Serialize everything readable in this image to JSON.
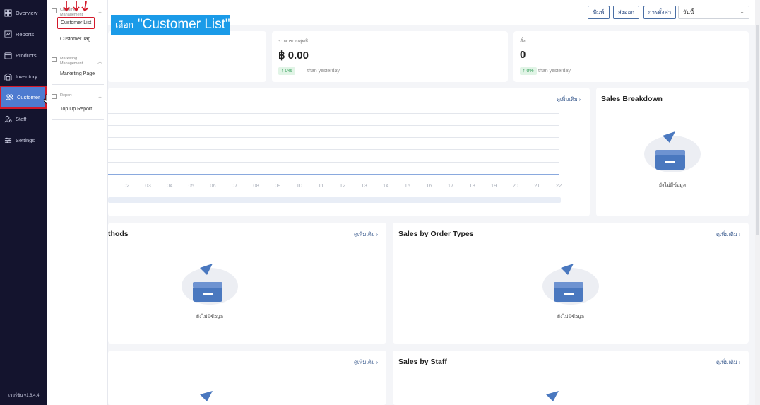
{
  "sidebar": {
    "items": [
      {
        "label": "Overview",
        "icon": "grid-icon"
      },
      {
        "label": "Reports",
        "icon": "chart-icon"
      },
      {
        "label": "Products",
        "icon": "box-icon"
      },
      {
        "label": "Inventory",
        "icon": "warehouse-icon"
      },
      {
        "label": "Customer",
        "icon": "users-icon",
        "active": true
      },
      {
        "label": "Staff",
        "icon": "user-gear-icon"
      },
      {
        "label": "Settings",
        "icon": "sliders-icon"
      }
    ],
    "version": "เวอร์ชัน v1.8.4.4"
  },
  "submenu": {
    "groups": [
      {
        "heading": "Customer Management",
        "items": [
          "Customer List",
          "Customer Tag"
        ]
      },
      {
        "heading": "Marketing Management",
        "items": [
          "Marketing Page"
        ]
      },
      {
        "heading": "Report",
        "items": [
          "Top Up Report"
        ]
      }
    ]
  },
  "toolbar": {
    "print_label": "พิมพ์",
    "export_label": "ส่งออก",
    "settings_label": "การตั้งค่า",
    "date_select": "วันนี้"
  },
  "annotation": {
    "prefix": "เลือก",
    "text": "\"Customer List\"",
    "color": "#1b9be8"
  },
  "stats": [
    {
      "label": "ราคาขายสุทธิ",
      "value": "฿ 0.00",
      "change": "0%",
      "change_suffix": "than yesterday"
    },
    {
      "label": "สั่ง",
      "value": "0",
      "change": "0%",
      "change_suffix": "than yesterday"
    }
  ],
  "chart": {
    "more_label": "ดูเพิ่มเติม",
    "x_ticks": [
      "02",
      "03",
      "04",
      "05",
      "06",
      "07",
      "08",
      "09",
      "10",
      "11",
      "12",
      "13",
      "14",
      "15",
      "16",
      "17",
      "18",
      "19",
      "20",
      "21",
      "22"
    ]
  },
  "panels": {
    "sales_breakdown": {
      "title": "Sales Breakdown",
      "empty": "ยังไม่มีข้อมูล"
    },
    "payment_methods": {
      "title": "thods",
      "more": "ดูเพิ่มเติม",
      "empty": "ยังไม่มีข้อมูล"
    },
    "order_types": {
      "title": "Sales by Order Types",
      "more": "ดูเพิ่มเติม",
      "empty": "ยังไม่มีข้อมูล"
    },
    "bottom_left": {
      "more": "ดูเพิ่มเติม"
    },
    "staff": {
      "title": "Sales by Staff",
      "more": "ดูเพิ่มเติม"
    }
  },
  "colors": {
    "sidebar_bg": "#14142e",
    "active": "#4e7bd0",
    "highlight": "#d3192a",
    "accent": "#34568b"
  }
}
